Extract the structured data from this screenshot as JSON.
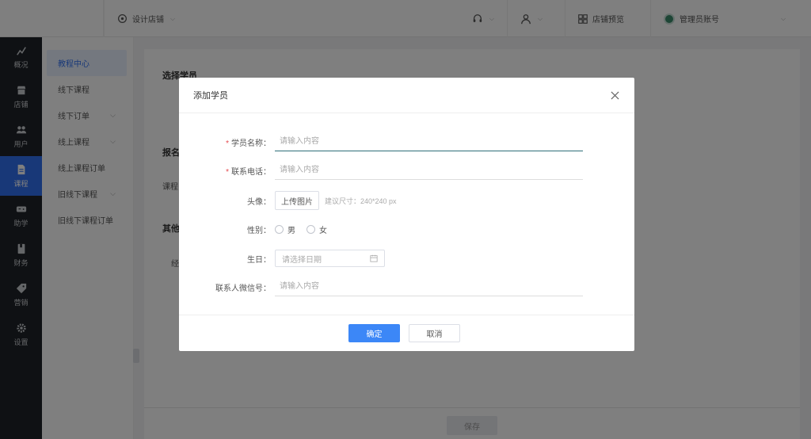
{
  "topbar": {
    "design_store": "设计店铺",
    "store_preview": "店铺预览",
    "account_name": "管理员账号"
  },
  "nav": {
    "items": [
      {
        "label": "概况",
        "icon": "chart-icon"
      },
      {
        "label": "店铺",
        "icon": "store-icon"
      },
      {
        "label": "用户",
        "icon": "users-icon"
      },
      {
        "label": "课程",
        "icon": "document-icon",
        "active": true
      },
      {
        "label": "助学",
        "icon": "gamepad-icon"
      },
      {
        "label": "财务",
        "icon": "book-icon"
      },
      {
        "label": "营销",
        "icon": "tag-icon"
      },
      {
        "label": "设置",
        "icon": "gear-icon"
      }
    ]
  },
  "subnav": {
    "items": [
      {
        "label": "教程中心",
        "active": true,
        "has_children": false
      },
      {
        "label": "线下课程",
        "has_children": false
      },
      {
        "label": "线下订单",
        "has_children": true
      },
      {
        "label": "线上课程",
        "has_children": true
      },
      {
        "label": "线上课程订单",
        "has_children": false
      },
      {
        "label": "旧线下课程",
        "has_children": true
      },
      {
        "label": "旧线下课程订单",
        "has_children": false
      }
    ]
  },
  "main": {
    "section1": "选择学员",
    "section2": "报名",
    "section2_field": "课程",
    "section3": "其他",
    "section3_field": "经",
    "save_label": "保存"
  },
  "modal": {
    "title": "添加学员",
    "fields": {
      "name_label": "学员名称：",
      "name_placeholder": "请输入内容",
      "phone_label": "联系电话：",
      "phone_placeholder": "请输入内容",
      "avatar_label": "头像：",
      "upload_label": "上传图片",
      "upload_hint": "建议尺寸：240*240 px",
      "gender_label": "性别：",
      "gender_male": "男",
      "gender_female": "女",
      "birthday_label": "生日：",
      "birthday_placeholder": "请选择日期",
      "wechat_label": "联系人微信号：",
      "wechat_placeholder": "请输入内容"
    },
    "confirm_label": "确定",
    "cancel_label": "取消"
  }
}
